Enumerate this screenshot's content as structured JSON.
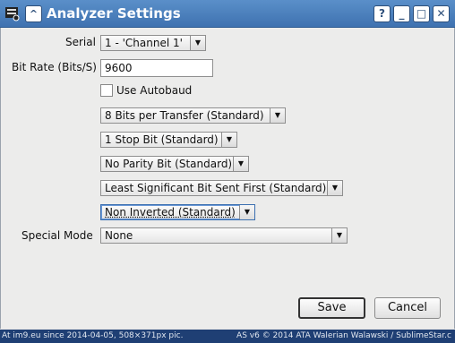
{
  "window": {
    "title": "Analyzer Settings",
    "help_label": "?",
    "minimize_label": "_",
    "maximize_label": "□",
    "close_label": "✕",
    "up_label": "^"
  },
  "form": {
    "serial_label": "Serial",
    "serial_value": "1 - 'Channel 1'",
    "bitrate_label": "Bit Rate (Bits/S)",
    "bitrate_value": "9600",
    "autobaud_label": "Use Autobaud",
    "autobaud_checked": false,
    "bits_per_transfer": "8 Bits per Transfer (Standard)",
    "stop_bits": "1 Stop Bit (Standard)",
    "parity": "No Parity Bit (Standard)",
    "bit_order": "Least Significant Bit Sent First (Standard)",
    "inversion": "Non Inverted (Standard)",
    "special_mode_label": "Special Mode",
    "special_mode_value": "None"
  },
  "buttons": {
    "save": "Save",
    "cancel": "Cancel"
  },
  "footer": {
    "left": "At im9.eu  since 2014-04-05, 508×371px pic.",
    "right": "AS v6 © 2014 ATA Walerian Walawski / SublimeStar.c"
  },
  "colors": {
    "titlebar": "#4a7fbf",
    "footer": "#1f3f74"
  }
}
